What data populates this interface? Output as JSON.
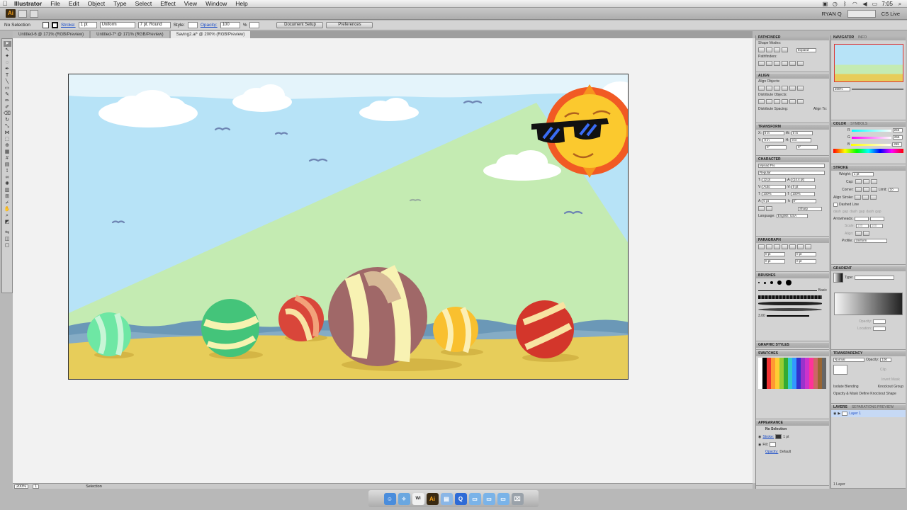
{
  "menubar": {
    "app_name": "Illustrator",
    "items": [
      "File",
      "Edit",
      "Object",
      "Type",
      "Select",
      "Effect",
      "View",
      "Window",
      "Help"
    ],
    "clock": "7:05"
  },
  "appbar": {
    "user": "RYAN Q",
    "cs_live": "CS Live"
  },
  "control": {
    "selection": "No Selection",
    "stroke_label": "Stroke:",
    "stroke_value": "1 pt",
    "profile": "Uniform",
    "brush": "7 pt. Round",
    "style_label": "Style:",
    "opacity_label": "Opacity:",
    "opacity_value": "100",
    "percent": "%",
    "doc_setup": "Document Setup",
    "preferences": "Preferences"
  },
  "tabs": [
    "Untitled-6 @ 171% (RGB/Preview)",
    "Untitled-7* @ 171% (RGB/Preview)",
    "Saving2.ai* @ 200% (RGB/Preview)"
  ],
  "status": {
    "zoom": "200%",
    "page": "1",
    "tool": "Selection"
  },
  "panels": {
    "pathfinder": {
      "title": "PATHFINDER",
      "shape_modes": "Shape Modes:",
      "pathfinders": "Pathfinders:",
      "expand": "Expand"
    },
    "align": {
      "title": "ALIGN",
      "align_objects": "Align Objects:",
      "distribute_objects": "Distribute Objects:",
      "distribute_spacing": "Distribute Spacing:",
      "align_to": "Align To:"
    },
    "transform": {
      "title": "TRANSFORM",
      "x": "X:",
      "y": "Y:",
      "w": "W:",
      "h": "H:",
      "zero": "0 in",
      "deg": "0°"
    },
    "character": {
      "title": "CHARACTER",
      "font": "Myriad Pro",
      "style": "Regular",
      "size": "12 pt",
      "leading": "(14.4 pt)",
      "auto": "Auto",
      "pct": "100%",
      "zero_pt": "0 pt",
      "sharp": "Sharp",
      "language_label": "Language:",
      "language": "English: USA"
    },
    "paragraph": {
      "title": "PARAGRAPH",
      "zero_pt": "0 pt"
    },
    "brushes": {
      "title": "BRUSHES",
      "basic": "Basic",
      "size": "3.00"
    },
    "graphic_styles": {
      "title": "GRAPHIC STYLES"
    },
    "swatches": {
      "title": "SWATCHES"
    },
    "appearance": {
      "title": "APPEARANCE",
      "selection": "No Selection",
      "stroke": "Stroke:",
      "stroke_val": "1 pt",
      "fill": "Fill:",
      "opacity": "Opacity:",
      "opacity_val": "Default"
    },
    "navigator": {
      "title": "NAVIGATOR",
      "info": "INFO",
      "zoom": "200%"
    },
    "color": {
      "title": "COLOR",
      "symbols": "SYMBOLS",
      "r": "R",
      "g": "G",
      "b": "B",
      "val": "255"
    },
    "stroke": {
      "title": "STROKE",
      "weight": "Weight:",
      "weight_val": "1 pt",
      "cap": "Cap:",
      "corner": "Corner:",
      "limit": "Limit:",
      "limit_val": "10",
      "align_stroke": "Align Stroke:",
      "dashed": "Dashed Line",
      "dash": "dash",
      "gap": "gap",
      "arrowheads": "Arrowheads:",
      "scale": "Scale:",
      "scale_val": "100",
      "align": "Align:",
      "profile": "Profile:",
      "profile_val": "Uniform"
    },
    "gradient": {
      "title": "GRADIENT",
      "type": "Type:",
      "opacity": "Opacity:",
      "location": "Location:"
    },
    "transparency": {
      "title": "TRANSPARENCY",
      "mode": "Normal",
      "opacity": "Opacity:",
      "opacity_val": "100",
      "clip": "Clip",
      "invert": "Invert Mask",
      "isolate": "Isolate Blending",
      "knockout": "Knockout Group",
      "define": "Opacity & Mask Define Knockout Shape"
    },
    "layers": {
      "title": "LAYERS",
      "separations": "SEPARATIONS PREVIEW",
      "layer1": "Layer 1",
      "count": "1 Layer"
    }
  },
  "colors": {
    "sky": "#b7e3f7",
    "green_beam": "#c4ebb2",
    "sand": "#e7cd5a",
    "sea": "#6b98b7",
    "sun": "#fbc92e",
    "sun_rays": "#f15a24"
  },
  "dock": [
    "finder-icon",
    "safari-icon",
    "wifi-icon",
    "illustrator-icon",
    "preview-icon",
    "quicktime-icon",
    "folder-icon",
    "trash-icon"
  ]
}
